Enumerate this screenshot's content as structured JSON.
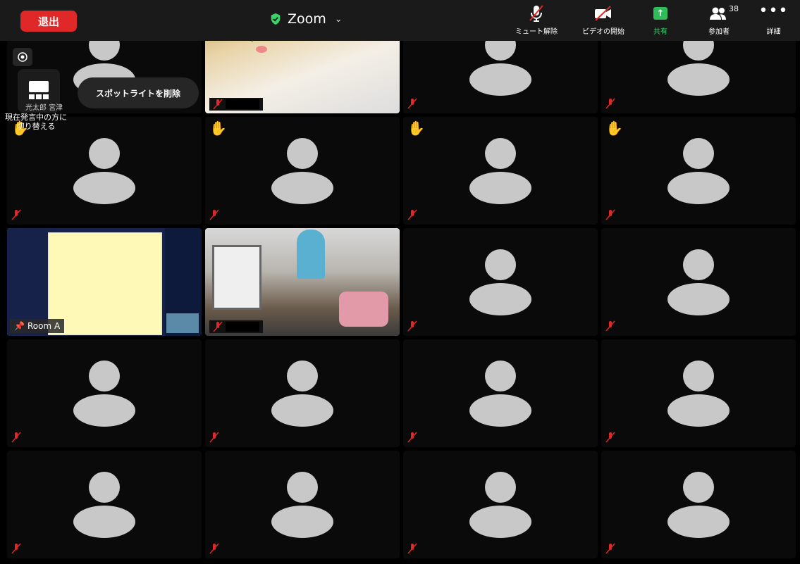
{
  "toolbar": {
    "leave_label": "退出",
    "app_title": "Zoom",
    "mute_label": "ミュート解除",
    "video_label": "ビデオの開始",
    "share_label": "共有",
    "participants_label": "参加者",
    "participants_count": "38",
    "more_label": "詳細"
  },
  "overlay": {
    "remove_spotlight_label": "スポットライトを削除",
    "switch_speaker_label": "現在発言中の方に切り替える",
    "partial_name": "光太郎 宮津"
  },
  "tiles": {
    "room_a_label": "Room A"
  },
  "colors": {
    "leave": "#e02828",
    "share": "#2ebd5a",
    "active_border": "#3fd46a",
    "avatar": "#c8c8c8"
  }
}
